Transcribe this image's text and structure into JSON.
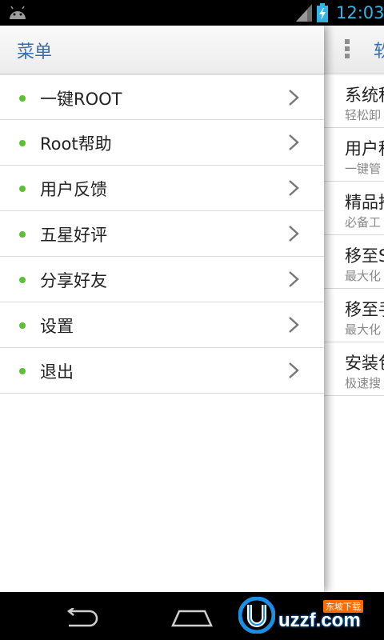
{
  "status_bar": {
    "time": "12:03",
    "accent": "#33b5e5",
    "icons": [
      "android-icon",
      "signal-icon",
      "battery-charging-icon"
    ]
  },
  "drawer": {
    "title": "菜单",
    "items": [
      {
        "label": "一键ROOT",
        "icon": "chevron-right-icon"
      },
      {
        "label": "Root帮助",
        "icon": "chevron-right-icon"
      },
      {
        "label": "用户反馈",
        "icon": "chevron-right-icon"
      },
      {
        "label": "五星好评",
        "icon": "chevron-right-icon"
      },
      {
        "label": "分享好友",
        "icon": "chevron-right-icon"
      },
      {
        "label": "设置",
        "icon": "chevron-right-icon"
      },
      {
        "label": "退出",
        "icon": "chevron-right-icon"
      }
    ],
    "bullet_color": "#5cc035",
    "title_color": "#2f6fb8"
  },
  "main": {
    "header_title": "软",
    "rows": [
      {
        "title": "系统程",
        "subtitle": "轻松卸"
      },
      {
        "title": "用户程",
        "subtitle": "一键管"
      },
      {
        "title": "精品推",
        "subtitle": "必备工"
      },
      {
        "title": "移至S",
        "subtitle": "最大化"
      },
      {
        "title": "移至手",
        "subtitle": "最大化"
      },
      {
        "title": "安装包",
        "subtitle": "极速搜"
      }
    ]
  },
  "nav_bar": {
    "icons": [
      "back-icon",
      "home-icon"
    ]
  },
  "watermark": {
    "top_text": "东坡下载",
    "text": "uzzf.com"
  }
}
